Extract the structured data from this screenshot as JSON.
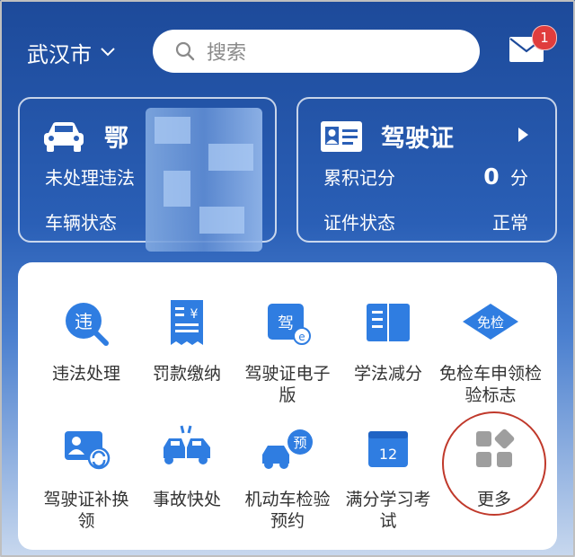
{
  "header": {
    "city": "武汉市",
    "search_placeholder": "搜索",
    "mail_badge": "1"
  },
  "vehicle_card": {
    "plate_prefix": "鄂",
    "violations_label": "未处理违法",
    "status_label": "车辆状态"
  },
  "license_card": {
    "title": "驾驶证",
    "points_label": "累积记分",
    "points_value": "0",
    "points_unit": "分",
    "status_label": "证件状态",
    "status_value": "正常"
  },
  "services": [
    {
      "label": "违法处理",
      "icon": "violation-search-icon"
    },
    {
      "label": "罚款缴纳",
      "icon": "fine-receipt-icon"
    },
    {
      "label": "驾驶证电子版",
      "icon": "e-license-icon"
    },
    {
      "label": "学法减分",
      "icon": "open-book-icon"
    },
    {
      "label": "免检车申领检验标志",
      "icon": "inspection-exempt-icon"
    },
    {
      "label": "驾驶证补换领",
      "icon": "license-renew-icon"
    },
    {
      "label": "事故快处",
      "icon": "accident-icon"
    },
    {
      "label": "机动车检验预约",
      "icon": "inspection-booking-icon"
    },
    {
      "label": "满分学习考试",
      "icon": "exam-calendar-icon"
    },
    {
      "label": "更多",
      "icon": "more-grid-icon"
    }
  ],
  "colors": {
    "brand_blue": "#1d4a9a",
    "icon_blue": "#2f7de1",
    "badge_red": "#e03d3d",
    "highlight_circle": "#c0392b"
  }
}
